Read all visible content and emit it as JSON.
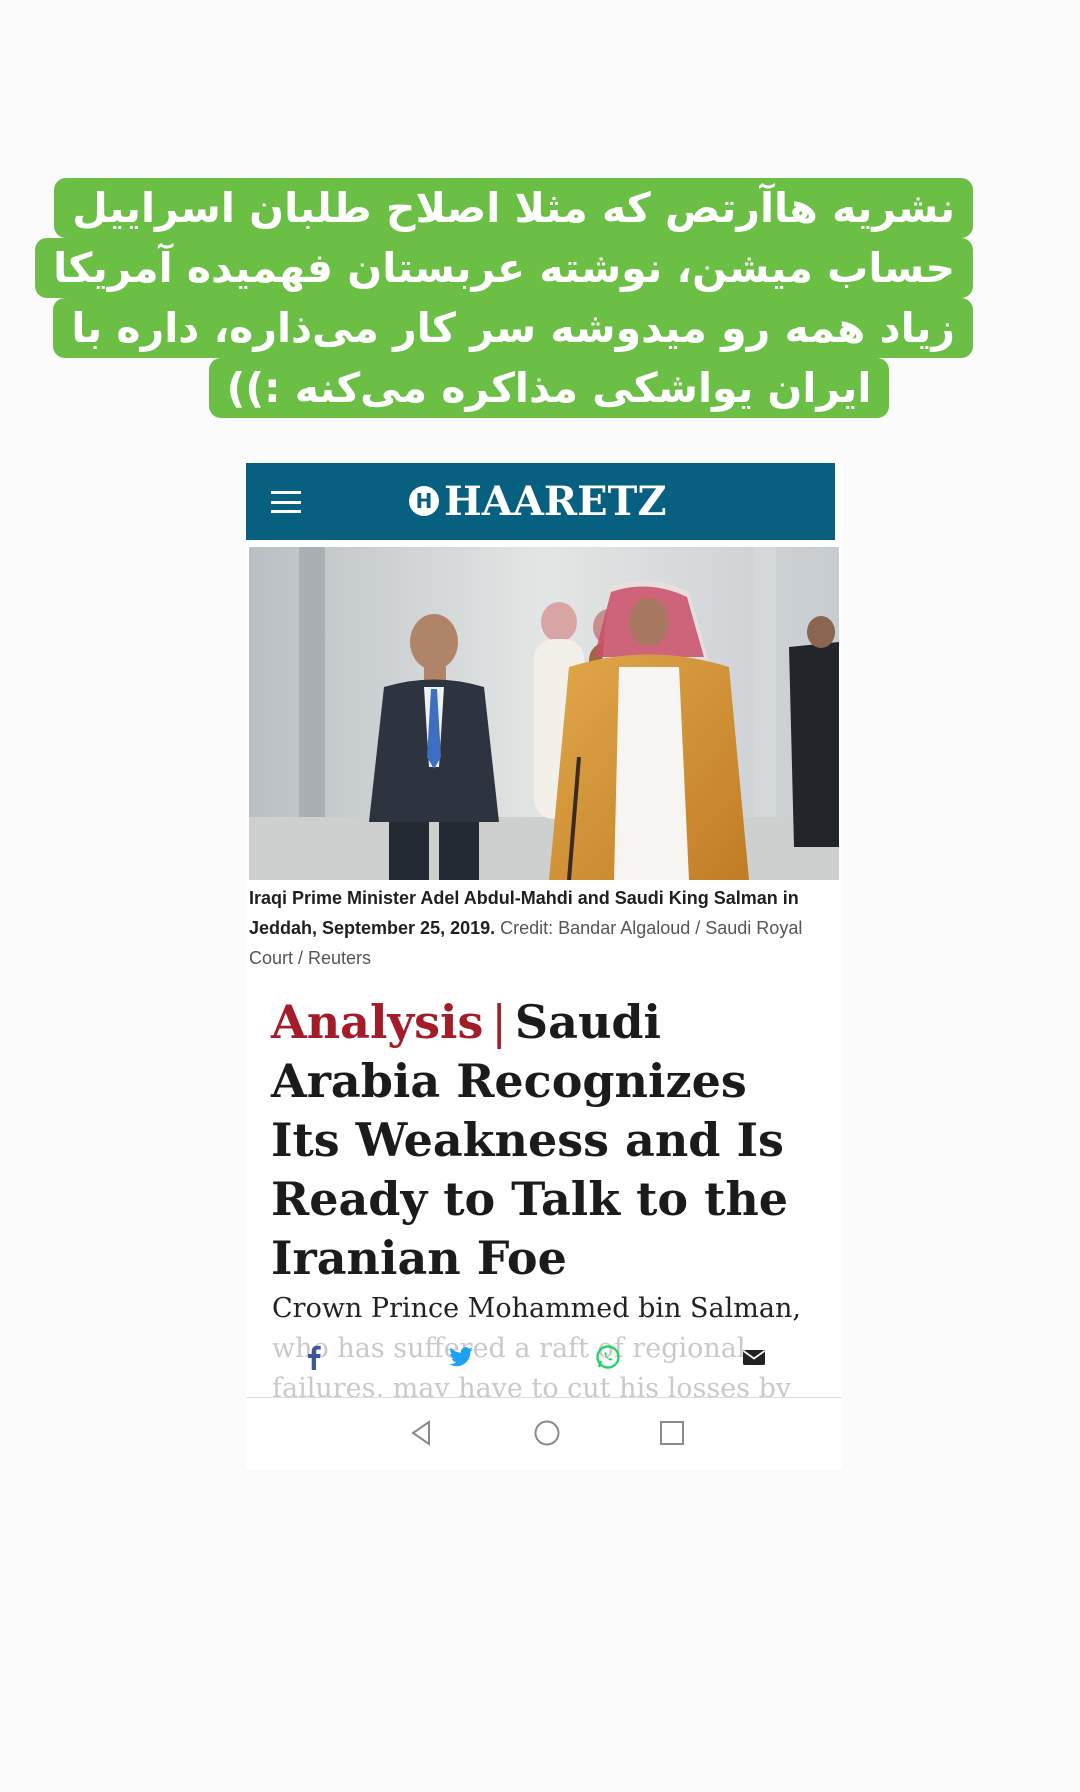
{
  "caption": {
    "lines": [
      "نشریه هاآرتص که مثلا اصلاح طلبان اسراییل",
      "حساب میشن، نوشته عربستان فهمیده آمریکا",
      "زیاد همه رو میدوشه سر کار می‌ذاره، داره با",
      "ایران یواشکی مذاکره می‌کنه :))"
    ],
    "background_color": "#6bbf45"
  },
  "header": {
    "logo_mark": "H",
    "logo_text": "HAARETZ",
    "menu_icon": "hamburger-icon",
    "background_color": "#07607f"
  },
  "photo": {
    "description_icon": "news-photo"
  },
  "photo_caption": {
    "lead": "Iraqi Prime Minister Adel Abdul-Mahdi and Saudi King Salman in Jeddah, September 25, 2019.",
    "credit": "Credit: Bandar Algaloud / Saudi Royal Court / Reuters"
  },
  "article": {
    "label": "Analysis",
    "separator": "|",
    "headline": "Saudi Arabia Recognizes Its Weakness and Is Ready to Talk to the Iranian Foe",
    "subhead_visible": "Crown Prince Mohammed bin Salman,",
    "subhead_faded": "who has suffered a raft of regional failures, may have to cut his losses by",
    "label_color": "#a41c2a"
  },
  "share": {
    "icons": [
      "facebook-icon",
      "twitter-icon",
      "whatsapp-icon",
      "email-icon"
    ],
    "colors": {
      "facebook": "#3b5998",
      "twitter": "#1da1f2",
      "whatsapp": "#25d366",
      "email": "#222222"
    }
  },
  "nav": {
    "icons": [
      "back-icon",
      "home-icon",
      "recents-icon"
    ]
  }
}
